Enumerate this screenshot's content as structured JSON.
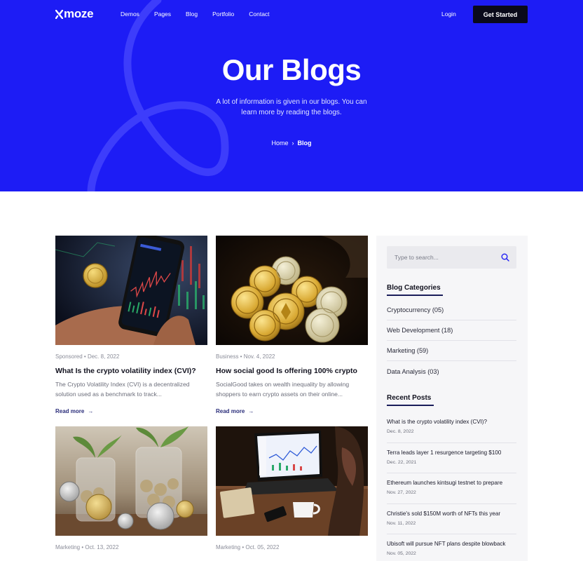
{
  "brand": {
    "name": "moze",
    "mark_icon": "x-logo-icon",
    "accent": "#1d1cf5"
  },
  "nav": {
    "links": [
      "Demos",
      "Pages",
      "Blog",
      "Portfolio",
      "Contact"
    ],
    "login": "Login",
    "cta": "Get Started"
  },
  "hero": {
    "title": "Our Blogs",
    "subtitle": "A lot of information is given in our blogs. You can learn more by reading the blogs.",
    "breadcrumb": {
      "home": "Home",
      "current": "Blog"
    }
  },
  "posts": [
    {
      "meta": "Sponsored • Dec. 8, 2022",
      "title": "What Is the crypto volatility index (CVI)?",
      "excerpt": "The Crypto Volatility Index (CVI) is a decentralized solution used as a benchmark to track...",
      "more": "Read more",
      "image": "hand holding phone with crypto chart"
    },
    {
      "meta": "Business • Nov. 4, 2022",
      "title": "How social good Is offering 100% crypto",
      "excerpt": "SocialGood takes on wealth inequality by allowing shoppers to earn crypto assets on their online...",
      "more": "Read more",
      "image": "pile of gold crypto coins"
    },
    {
      "meta": "Marketing • Oct. 13, 2022",
      "title": "",
      "image": "coins in glass jars with plants"
    },
    {
      "meta": "Marketing • Oct. 05, 2022",
      "title": "",
      "image": "person using laptop with trading dashboard"
    }
  ],
  "sidebar": {
    "search_placeholder": "Type to search...",
    "categories_title": "Blog Categories",
    "categories": [
      "Cryptocurrency (05)",
      "Web Development (18)",
      "Marketing (59)",
      "Data Analysis (03)"
    ],
    "recent_title": "Recent Posts",
    "recent": [
      {
        "title": "What is the crypto volatility index (CVI)?",
        "date": "Dec. 8, 2022"
      },
      {
        "title": "Terra leads layer 1 resurgence targeting $100",
        "date": "Dec. 22, 2021"
      },
      {
        "title": "Ethereum launches kintsugi testnet to prepare",
        "date": "Nov. 27, 2022"
      },
      {
        "title": "Christie's sold $150M worth of NFTs this year",
        "date": "Nov. 11, 2022"
      },
      {
        "title": "Ubisoft will pursue NFT plans despite blowback",
        "date": "Nov. 05, 2022"
      }
    ]
  }
}
